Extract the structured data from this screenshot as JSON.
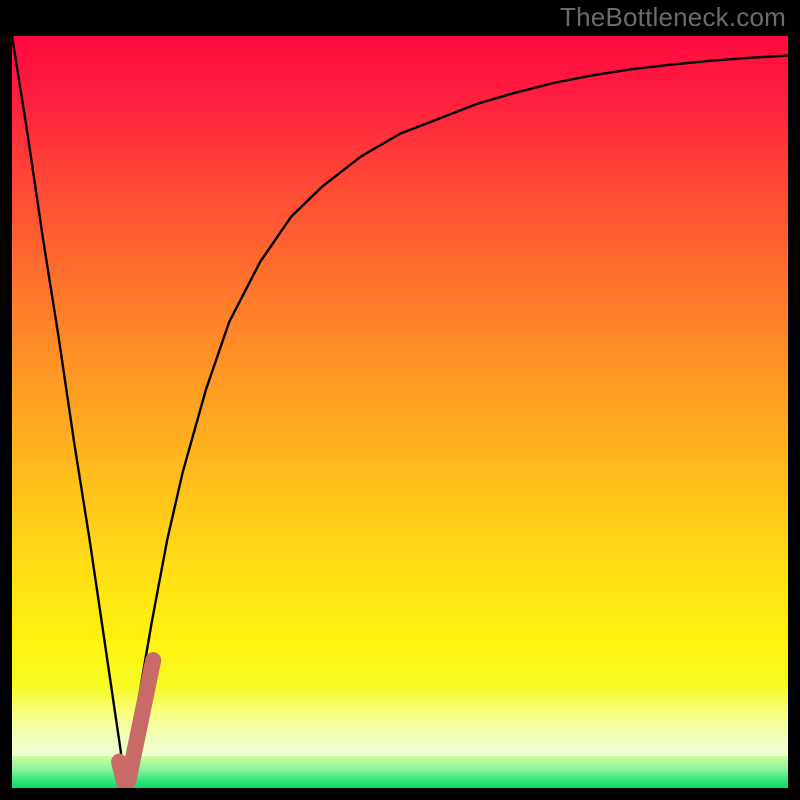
{
  "attribution": "TheBottleneck.com",
  "chart_data": {
    "type": "line",
    "title": "",
    "xlabel": "",
    "ylabel": "",
    "xlim": [
      0,
      100
    ],
    "ylim": [
      0,
      100
    ],
    "grid": false,
    "series": [
      {
        "name": "bottleneck-curve",
        "x": [
          0,
          2,
          4,
          6,
          8,
          10,
          12,
          14,
          14.5,
          15,
          16,
          18,
          20,
          22,
          25,
          28,
          32,
          36,
          40,
          45,
          50,
          55,
          60,
          65,
          70,
          75,
          80,
          85,
          90,
          95,
          100
        ],
        "y": [
          100,
          87,
          73,
          60,
          46,
          33,
          19,
          5,
          0,
          3,
          10,
          22,
          33,
          42,
          53,
          62,
          70,
          76,
          80,
          84,
          87,
          89,
          91,
          92.5,
          93.8,
          94.8,
          95.6,
          96.2,
          96.7,
          97.1,
          97.4
        ]
      },
      {
        "name": "highlight-segment",
        "x": [
          13.8,
          14.2,
          14.5,
          15.0,
          15.8,
          16.6,
          17.4,
          18.2
        ],
        "y": [
          3.5,
          1.8,
          0.5,
          1.0,
          5.0,
          9.0,
          13.0,
          17.0
        ]
      }
    ],
    "gradient_stops": [
      {
        "pos": 0.0,
        "color": "#ff0a3e"
      },
      {
        "pos": 0.08,
        "color": "#ff1e3e"
      },
      {
        "pos": 0.18,
        "color": "#ff4236"
      },
      {
        "pos": 0.3,
        "color": "#ff6a2e"
      },
      {
        "pos": 0.42,
        "color": "#ff8f26"
      },
      {
        "pos": 0.55,
        "color": "#ffb31e"
      },
      {
        "pos": 0.68,
        "color": "#ffd716"
      },
      {
        "pos": 0.8,
        "color": "#fff20e"
      },
      {
        "pos": 0.9,
        "color": "#f2ff2e"
      },
      {
        "pos": 0.955,
        "color": "#d8ffa0"
      },
      {
        "pos": 0.975,
        "color": "#8cf59a"
      },
      {
        "pos": 0.99,
        "color": "#2fe57a"
      },
      {
        "pos": 1.0,
        "color": "#17d968"
      }
    ],
    "highlight_color": "#c76a68",
    "curve_color": "#000000"
  }
}
